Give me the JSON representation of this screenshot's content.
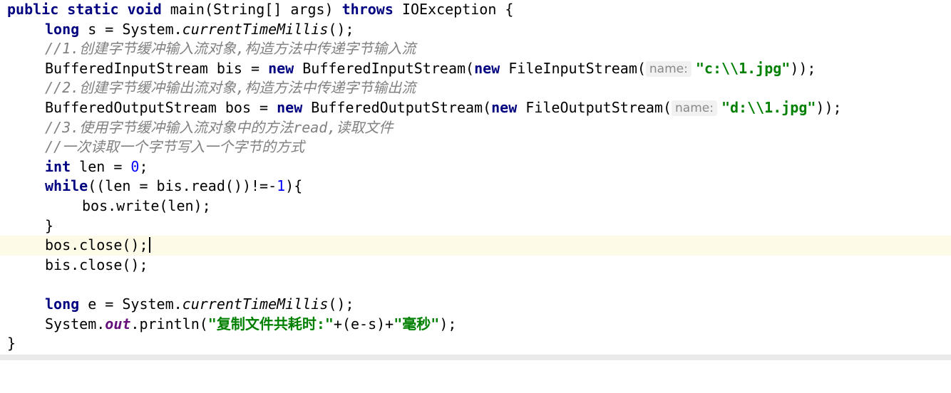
{
  "editor": {
    "language": "Java",
    "lines": {
      "l0": {
        "kw1": "public static void",
        "text1": " main(String[] args) ",
        "kw2": "throws",
        "text2": " IOException {"
      },
      "l1": {
        "kw1": "long",
        "text1": " s = System.",
        "method": "currentTimeMillis",
        "text2": "();"
      },
      "l2": {
        "comment": "//1.创建字节缓冲输入流对象,构造方法中传递字节输入流"
      },
      "l3": {
        "text1": "BufferedInputStream bis = ",
        "kw1": "new",
        "text2": " BufferedInputStream(",
        "kw2": "new",
        "text3": " FileInputStream(",
        "hint": "name:",
        "str": "\"c:\\\\1.jpg\"",
        "text4": "));"
      },
      "l4": {
        "comment": "//2.创建字节缓冲输出流对象,构造方法中传递字节输出流"
      },
      "l5": {
        "text1": "BufferedOutputStream bos = ",
        "kw1": "new",
        "text2": " BufferedOutputStream(",
        "kw2": "new",
        "text3": " FileOutputStream(",
        "hint": "name:",
        "str": "\"d:\\\\1.jpg\"",
        "text4": "));"
      },
      "l6": {
        "comment1": "//3.使用字节缓冲输入流对象中的方法",
        "comment_word": "read",
        "comment2": ",读取文件"
      },
      "l7": {
        "comment": "//一次读取一个字节写入一个字节的方式"
      },
      "l8": {
        "kw1": "int",
        "text1": " len = ",
        "num": "0",
        "text2": ";"
      },
      "l9": {
        "kw1": "while",
        "text1": "((len = bis.read())!=-",
        "num": "1",
        "text2": "){"
      },
      "l10": {
        "text1": "bos.write(len);"
      },
      "l11": {
        "text1": "}"
      },
      "l12": {
        "text1": "bos.close();"
      },
      "l13": {
        "text1": "bis.close();"
      },
      "l14": {
        "text1": ""
      },
      "l15": {
        "kw1": "long",
        "text1": " e = System.",
        "method": "currentTimeMillis",
        "text2": "();"
      },
      "l16": {
        "text1": "System.",
        "field": "out",
        "text2": ".println(",
        "str1": "\"复制文件共耗时:\"",
        "text3": "+(e-s)+",
        "str2": "\"毫秒\"",
        "text4": ");"
      },
      "l17": {
        "text1": "}"
      }
    }
  },
  "colors": {
    "background": "#ffffff",
    "keyword": "#000080",
    "comment": "#808080",
    "string": "#008000",
    "number": "#0000ff",
    "field": "#660e7a",
    "current_line": "#fdfbe7"
  }
}
